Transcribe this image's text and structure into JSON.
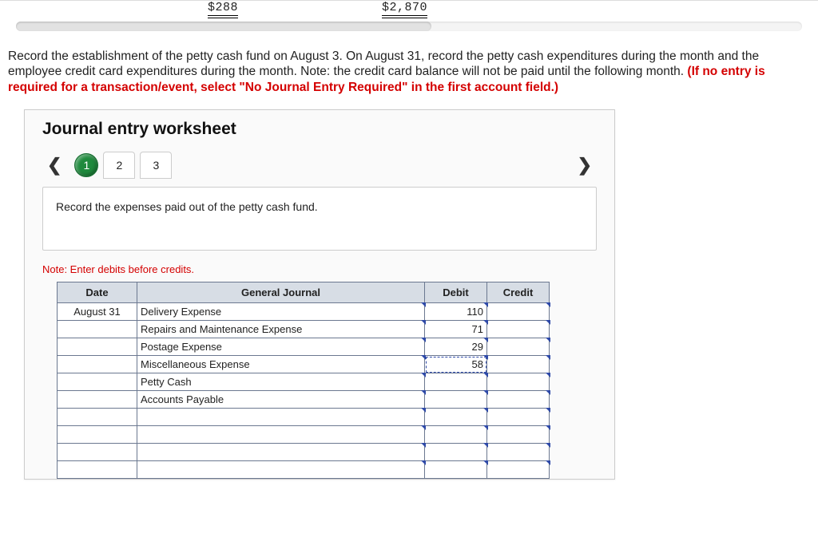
{
  "top": {
    "amount1": "$288",
    "amount2": "$2,870"
  },
  "instruction": {
    "line": "Record the establishment of the petty cash fund on August 3. On August 31, record the petty cash expenditures during the month and the employee credit card expenditures during the month. Note: the credit card balance will not be paid until the following month. ",
    "red": "(If no entry is required for a transaction/event, select \"No Journal Entry Required\" in the first account field.)"
  },
  "worksheet": {
    "title": "Journal entry worksheet",
    "steps": [
      "1",
      "2",
      "3"
    ],
    "prompt": "Record the expenses paid out of the petty cash fund.",
    "note": "Note: Enter debits before credits.",
    "headers": {
      "date": "Date",
      "gj": "General Journal",
      "debit": "Debit",
      "credit": "Credit"
    },
    "rows": [
      {
        "date": "August 31",
        "account": "Delivery Expense",
        "debit": "110",
        "credit": ""
      },
      {
        "date": "",
        "account": "Repairs and Maintenance Expense",
        "debit": "71",
        "credit": ""
      },
      {
        "date": "",
        "account": "Postage Expense",
        "debit": "29",
        "credit": ""
      },
      {
        "date": "",
        "account": "Miscellaneous Expense",
        "debit": "58",
        "credit": ""
      },
      {
        "date": "",
        "account": "Petty Cash",
        "debit": "",
        "credit": ""
      },
      {
        "date": "",
        "account": "Accounts Payable",
        "debit": "",
        "credit": ""
      },
      {
        "date": "",
        "account": "",
        "debit": "",
        "credit": ""
      },
      {
        "date": "",
        "account": "",
        "debit": "",
        "credit": ""
      },
      {
        "date": "",
        "account": "",
        "debit": "",
        "credit": ""
      },
      {
        "date": "",
        "account": "",
        "debit": "",
        "credit": ""
      }
    ]
  }
}
